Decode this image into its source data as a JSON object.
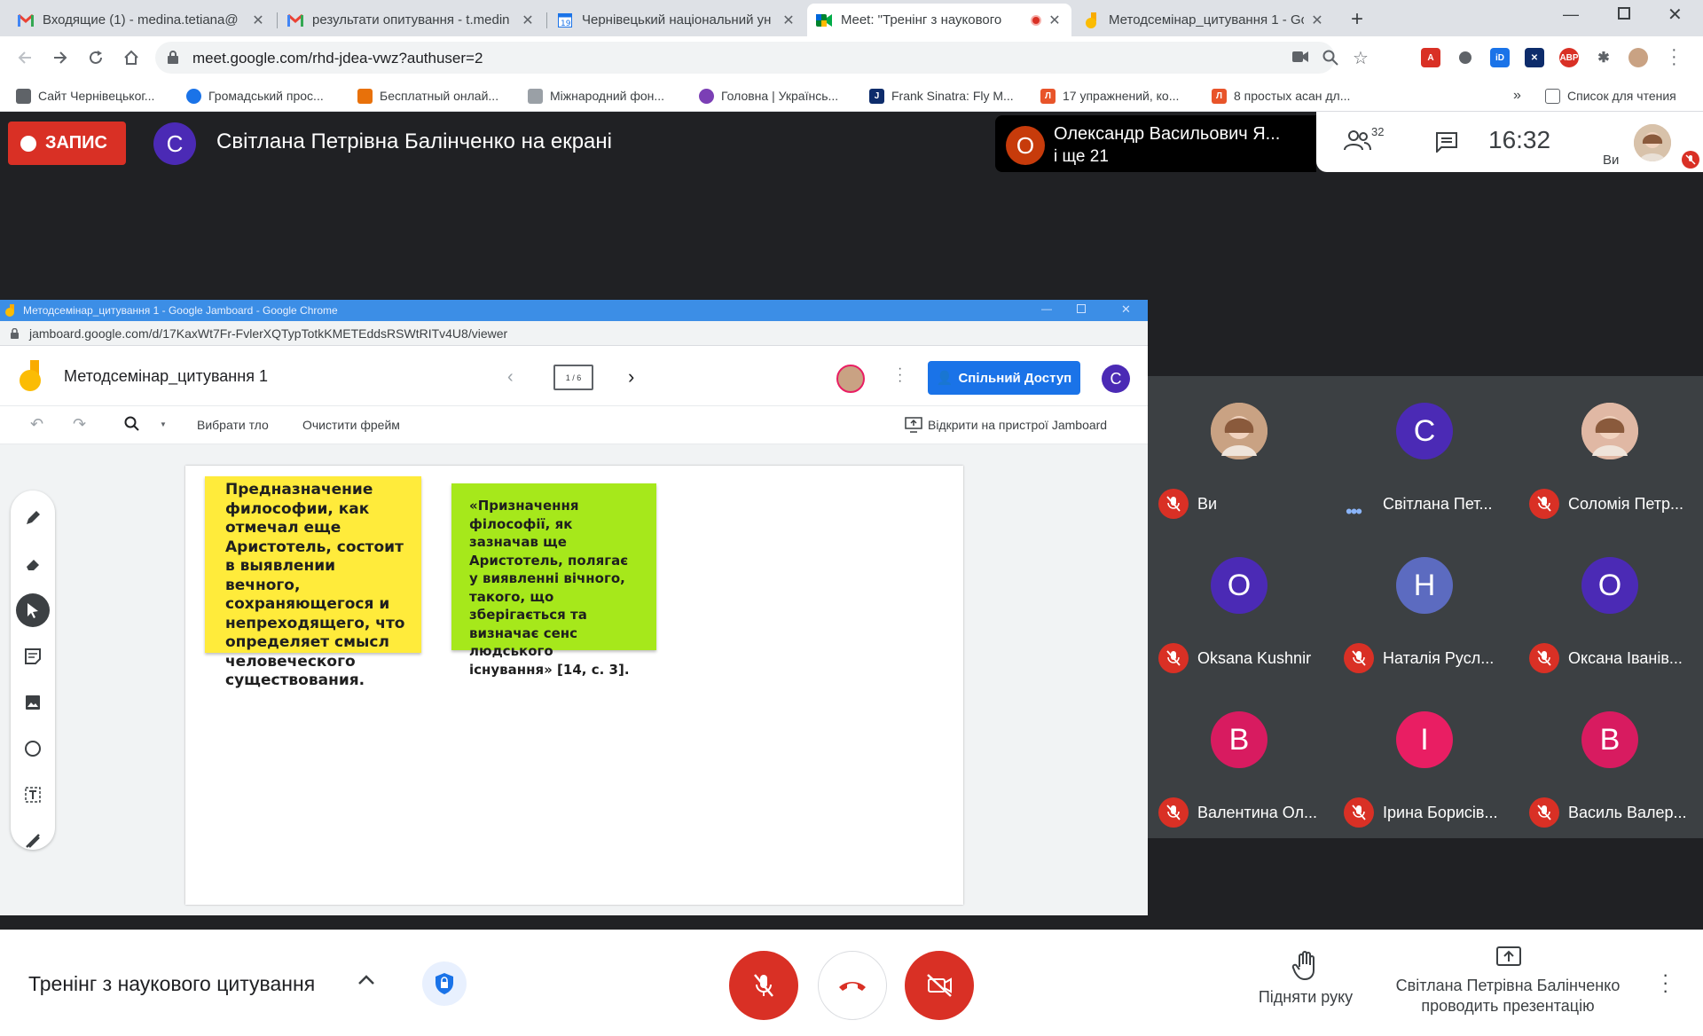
{
  "browser": {
    "tabs": [
      {
        "title": "Входящие (1) - medina.tetiana@",
        "icon": "gmail-icon"
      },
      {
        "title": "результати опитування - t.medin",
        "icon": "gmail-icon"
      },
      {
        "title": "Чернівецький національний ун",
        "icon": "calendar-icon"
      },
      {
        "title": "Meet: \"Тренінг з наукового",
        "icon": "meet-icon",
        "active": true
      },
      {
        "title": "Методсемінар_цитування 1 - Go",
        "icon": "jamboard-icon"
      }
    ],
    "url": "meet.google.com/rhd-jdea-vwz?authuser=2",
    "bookmarks": [
      {
        "label": "Сайт Чернівецьког...",
        "color": "#5f6368"
      },
      {
        "label": "Громадський прос...",
        "color": "#1a73e8"
      },
      {
        "label": "Бесплатный онлай...",
        "color": "#e8710a"
      },
      {
        "label": "Міжнародний фон...",
        "color": "#9aa0a6"
      },
      {
        "label": "Головна | Українсь...",
        "color": "#7b3fb5"
      },
      {
        "label": "Frank Sinatra: Fly M...",
        "color": "#0d2c6b"
      },
      {
        "label": "17 упражнений, ко...",
        "color": "#e8542a"
      },
      {
        "label": "8 простых асан дл...",
        "color": "#e8542a"
      }
    ],
    "reading_list": "Список для чтения",
    "more_bookmarks": "»"
  },
  "meet": {
    "record_label": "ЗАПИС",
    "presenter_initial": "С",
    "presenting_title": "Світлана Петрівна Балінченко на екрані",
    "active_speaker": {
      "initial": "О",
      "name": "Олександр Васильович Я...",
      "others": "і ще 21"
    },
    "participant_count": "32",
    "clock": "16:32",
    "self_label": "Ви",
    "meeting_name": "Тренінг з наукового цитування",
    "raise_hand": "Підняти руку",
    "presenting_note": "Світлана Петрівна Балінченко проводить презентацію",
    "participants": [
      {
        "name": "Ви",
        "initial": "",
        "color": "#c9a283",
        "photo": true,
        "muted": true
      },
      {
        "name": "Світлана Пет...",
        "initial": "С",
        "color": "#4b2ab5",
        "muted": false
      },
      {
        "name": "Соломія Петр...",
        "initial": "",
        "color": "#e0b8a4",
        "photo": true,
        "muted": true
      },
      {
        "name": "Oksana Kushnir",
        "initial": "O",
        "color": "#4b2ab5",
        "muted": true
      },
      {
        "name": "Наталія Русл...",
        "initial": "Н",
        "color": "#5c6bc0",
        "muted": true
      },
      {
        "name": "Оксана Іванів...",
        "initial": "О",
        "color": "#4b2ab5",
        "muted": true
      },
      {
        "name": "Валентина Ол...",
        "initial": "В",
        "color": "#d81b60",
        "muted": true
      },
      {
        "name": "Ірина Борисів...",
        "initial": "І",
        "color": "#e91e63",
        "muted": true
      },
      {
        "name": "Василь Валер...",
        "initial": "В",
        "color": "#d81b60",
        "muted": true
      }
    ]
  },
  "shared": {
    "window_title": "Методсемінар_цитування 1 - Google Jamboard - Google Chrome",
    "url": "jamboard.google.com/d/17KaxWt7Fr-FvlerXQTypTotkKMETEddsRSWtRITv4U8/viewer",
    "doc_title": "Методсемінар_цитування 1",
    "frame_indicator": "1 / 6",
    "share_label": "Спільний Доступ",
    "user_initial": "C",
    "toolbar": {
      "set_background": "Вибрати тло",
      "clear_frame": "Очистити фрейм",
      "open_device": "Відкрити на пристрої Jamboard"
    },
    "sticky_ru": "Предназначение\nфилософии, как\nотмечал еще\nАристотель, состоит\nв выявлении\nвечного,\nсохраняющегося и\nнепреходящего, что\nопределяет смысл\nчеловеческого\nсуществования.",
    "sticky_uk": "«Призначення\nфілософії, як\nзазначав ще\nАристотель, полягає\nу виявленні вічного,\nтакого, що\nзберігається та\nвизначає сенс\nлюдського\nіснування» [14, с. 3]."
  },
  "colors": {
    "accent": "#1a73e8",
    "danger": "#d93025",
    "sticky_yellow": "#ffeb3b",
    "sticky_green": "#a6e81b"
  }
}
